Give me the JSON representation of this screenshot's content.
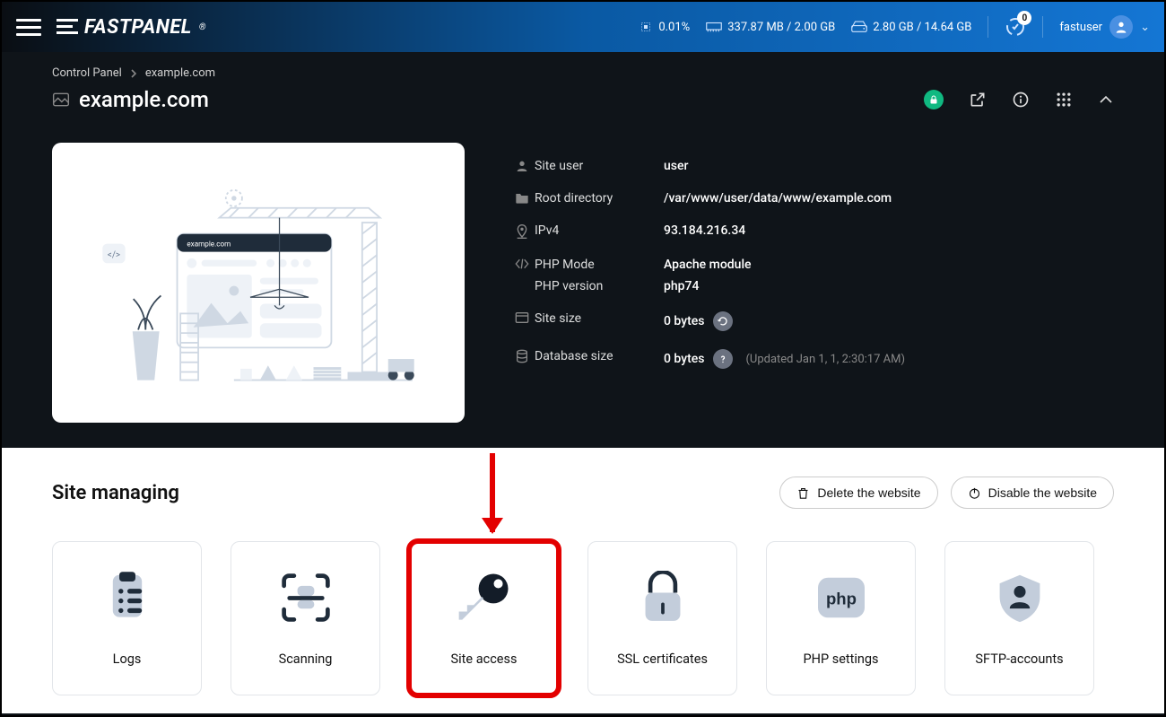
{
  "header": {
    "brand": "FASTPANEL",
    "cpu": "0.01%",
    "ram": "337.87 MB / 2.00 GB",
    "disk": "2.80 GB / 14.64 GB",
    "notifications": "0",
    "username": "fastuser"
  },
  "breadcrumb": {
    "root": "Control Panel",
    "current": "example.com"
  },
  "page": {
    "title": "example.com"
  },
  "info": {
    "user_label": "Site user",
    "user_value": "user",
    "root_label": "Root directory",
    "root_value": "/var/www/user/data/www/example.com",
    "ipv4_label": "IPv4",
    "ipv4_value": "93.184.216.34",
    "phpmode_label": "PHP Mode",
    "phpmode_value": "Apache module",
    "phpver_label": "PHP version",
    "phpver_value": "php74",
    "sitesize_label": "Site size",
    "sitesize_value": "0 bytes",
    "dbsize_label": "Database size",
    "dbsize_value": "0 bytes",
    "updated": "(Updated Jan 1, 1, 2:30:17 AM)"
  },
  "managing": {
    "title": "Site managing",
    "delete_label": "Delete the website",
    "disable_label": "Disable the website",
    "cards": {
      "logs": "Logs",
      "scanning": "Scanning",
      "siteaccess": "Site access",
      "ssl": "SSL certificates",
      "php": "PHP settings",
      "sftp": "SFTP-accounts"
    }
  },
  "screenshot_domain": "example.com"
}
